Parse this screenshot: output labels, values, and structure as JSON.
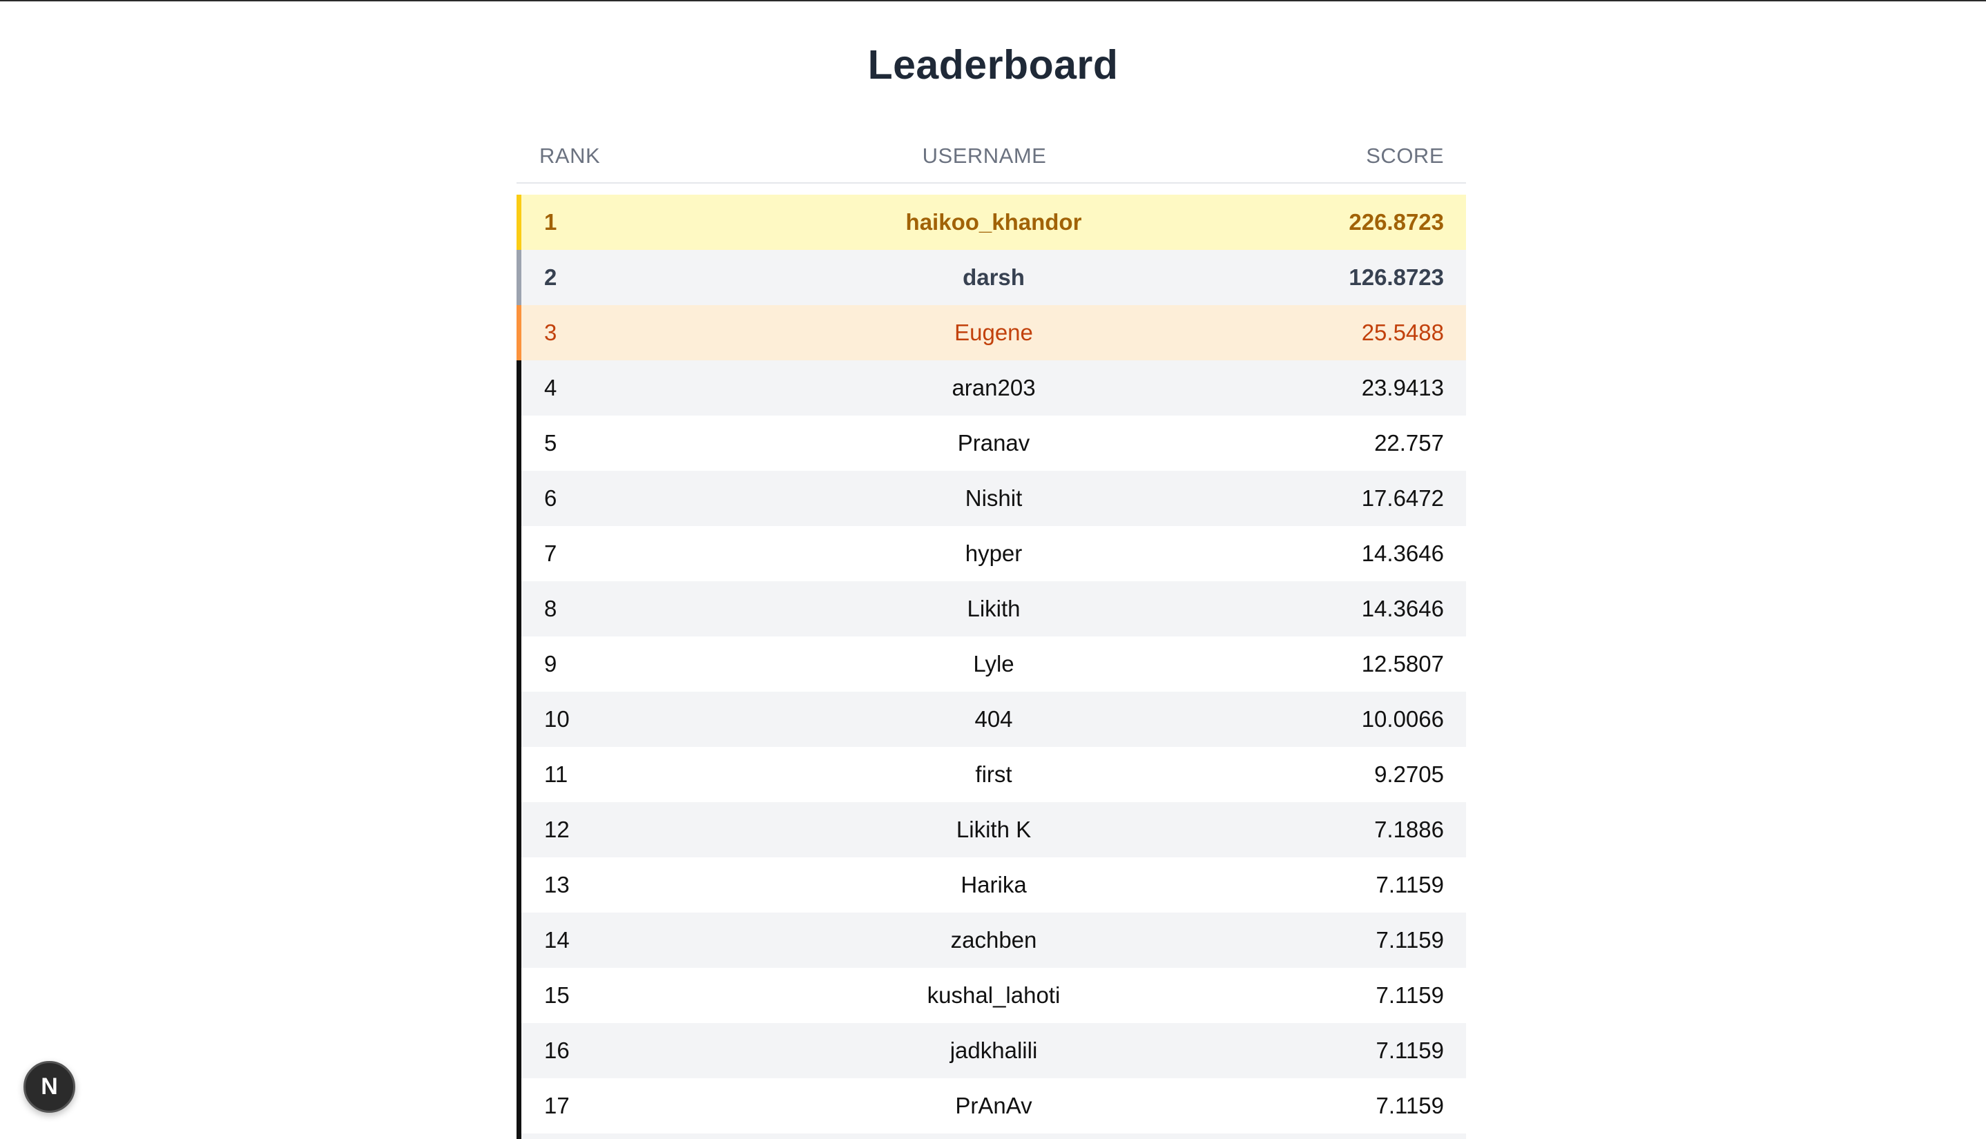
{
  "page": {
    "title": "Leaderboard"
  },
  "table": {
    "headers": {
      "rank": "RANK",
      "username": "USERNAME",
      "score": "SCORE"
    },
    "rows": [
      {
        "rank": "1",
        "username": "haikoo_khandor",
        "score": "226.8723",
        "tier": "gold"
      },
      {
        "rank": "2",
        "username": "darsh",
        "score": "126.8723",
        "tier": "silver"
      },
      {
        "rank": "3",
        "username": "Eugene",
        "score": "25.5488",
        "tier": "bronze"
      },
      {
        "rank": "4",
        "username": "aran203",
        "score": "23.9413",
        "tier": ""
      },
      {
        "rank": "5",
        "username": "Pranav",
        "score": "22.757",
        "tier": ""
      },
      {
        "rank": "6",
        "username": "Nishit",
        "score": "17.6472",
        "tier": ""
      },
      {
        "rank": "7",
        "username": "hyper",
        "score": "14.3646",
        "tier": ""
      },
      {
        "rank": "8",
        "username": "Likith",
        "score": "14.3646",
        "tier": ""
      },
      {
        "rank": "9",
        "username": "Lyle",
        "score": "12.5807",
        "tier": ""
      },
      {
        "rank": "10",
        "username": "404",
        "score": "10.0066",
        "tier": ""
      },
      {
        "rank": "11",
        "username": "first",
        "score": "9.2705",
        "tier": ""
      },
      {
        "rank": "12",
        "username": "Likith K",
        "score": "7.1886",
        "tier": ""
      },
      {
        "rank": "13",
        "username": "Harika",
        "score": "7.1159",
        "tier": ""
      },
      {
        "rank": "14",
        "username": "zachben",
        "score": "7.1159",
        "tier": ""
      },
      {
        "rank": "15",
        "username": "kushal_lahoti",
        "score": "7.1159",
        "tier": ""
      },
      {
        "rank": "16",
        "username": "jadkhalili",
        "score": "7.1159",
        "tier": ""
      },
      {
        "rank": "17",
        "username": "PrAnAv",
        "score": "7.1159",
        "tier": ""
      },
      {
        "rank": "",
        "username": "",
        "score": "",
        "tier": ""
      }
    ]
  },
  "badge": {
    "letter": "N",
    "icon": "nextjs-logo-icon"
  },
  "colors": {
    "gold_bg": "#fef9c3",
    "gold_accent": "#facc15",
    "gold_text": "#a16207",
    "silver_bg": "#f3f4f6",
    "silver_accent": "#9ca3af",
    "bronze_bg": "#fdeed8",
    "bronze_accent": "#fb923c",
    "bronze_text": "#c2410c"
  }
}
